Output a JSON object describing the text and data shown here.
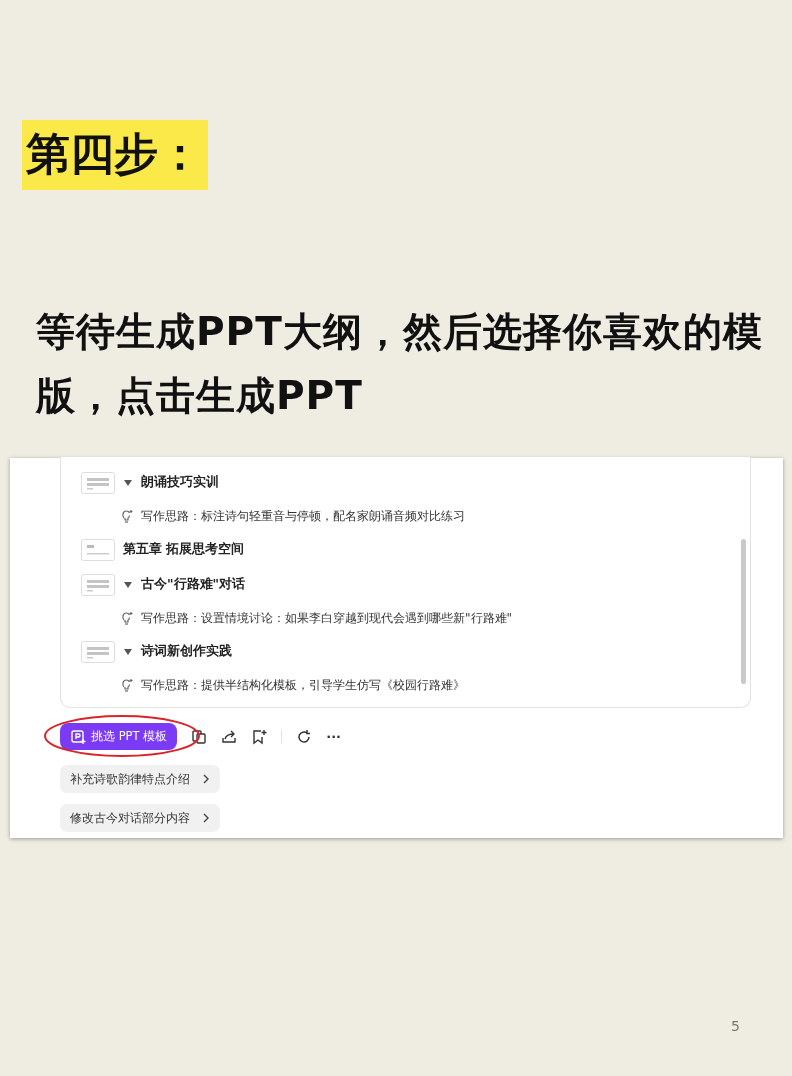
{
  "step_title": "第四步：",
  "instruction": "等待生成PPT大纲，然后选择你喜欢的模版，点击生成PPT",
  "outline": [
    {
      "kind": "section",
      "title": "朗诵技巧实训",
      "expanded": true
    },
    {
      "kind": "note",
      "text": "写作思路：标注诗句轻重音与停顿，配名家朗诵音频对比练习"
    },
    {
      "kind": "chapter",
      "title": "第五章 拓展思考空间"
    },
    {
      "kind": "section",
      "title": "古今\"行路难\"对话",
      "expanded": true
    },
    {
      "kind": "note",
      "text": "写作思路：设置情境讨论：如果李白穿越到现代会遇到哪些新\"行路难\""
    },
    {
      "kind": "section",
      "title": "诗词新创作实践",
      "expanded": true
    },
    {
      "kind": "note",
      "text": "写作思路：提供半结构化模板，引导学生仿写《校园行路难》"
    }
  ],
  "primary_button": "挑选 PPT 模板",
  "toolbar_more": "···",
  "suggestions": [
    {
      "label": "补充诗歌韵律特点介绍"
    },
    {
      "label": "修改古今对话部分内容"
    }
  ],
  "page_number": "5"
}
